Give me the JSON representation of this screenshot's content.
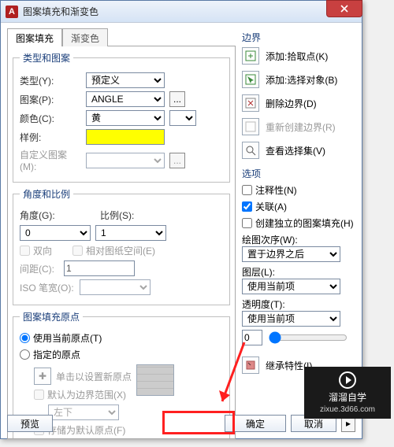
{
  "window": {
    "title": "图案填充和渐变色"
  },
  "tabs": {
    "active": "图案填充",
    "inactive": "渐变色"
  },
  "type_pattern": {
    "legend": "类型和图案",
    "type_label": "类型(Y):",
    "type_value": "预定义",
    "pattern_label": "图案(P):",
    "pattern_value": "ANGLE",
    "color_label": "颜色(C):",
    "color_value": "黄",
    "sample_label": "样例:",
    "custom_label": "自定义图案(M):"
  },
  "angle_scale": {
    "legend": "角度和比例",
    "angle_label": "角度(G):",
    "angle_value": "0",
    "scale_label": "比例(S):",
    "scale_value": "1",
    "double_label": "双向",
    "paperspace_label": "相对图纸空间(E)",
    "spacing_label": "间距(C):",
    "spacing_value": "1",
    "iso_label": "ISO 笔宽(O):"
  },
  "origin": {
    "legend": "图案填充原点",
    "use_current": "使用当前原点(T)",
    "specify": "指定的原点",
    "click_set": "单击以设置新原点",
    "default_ext": "默认为边界范围(X)",
    "corner": "左下",
    "store": "存储为默认原点(F)"
  },
  "boundary": {
    "heading": "边界",
    "add_pick": "添加:拾取点(K)",
    "add_select": "添加:选择对象(B)",
    "remove": "删除边界(D)",
    "recreate": "重新创建边界(R)",
    "view_sel": "查看选择集(V)"
  },
  "options": {
    "heading": "选项",
    "annotative": "注释性(N)",
    "assoc": "关联(A)",
    "independent": "创建独立的图案填充(H)",
    "draworder_label": "绘图次序(W):",
    "draworder_value": "置于边界之后",
    "layer_label": "图层(L):",
    "layer_value": "使用当前项",
    "transparency_label": "透明度(T):",
    "transparency_value": "使用当前项",
    "transparency_num": "0",
    "inherit": "继承特性(I)"
  },
  "footer": {
    "preview": "预览",
    "ok": "确定",
    "cancel": "取消",
    "help": "?"
  }
}
